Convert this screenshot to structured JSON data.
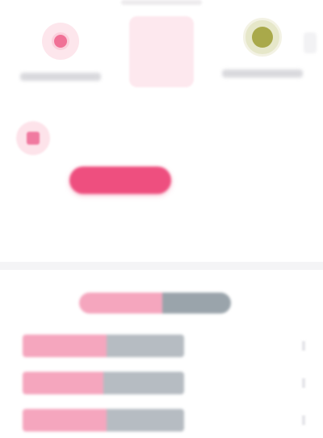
{
  "header": {
    "home_team": {
      "crest_icon": "club-crest-icon",
      "name": "",
      "color": "#f07196"
    },
    "away_team": {
      "crest_icon": "club-crest-icon",
      "name": "",
      "color": "#a9a94a"
    },
    "score": "",
    "status": ""
  },
  "tabs": {
    "icon": "match-icon",
    "items": [
      "",
      "",
      ""
    ]
  },
  "pills": {
    "items": [
      "",
      "",
      ""
    ],
    "active_index": 1,
    "accent": "#ee4f7f"
  },
  "options": {
    "items": [
      "",
      "",
      ""
    ],
    "sub": ""
  },
  "stats": {
    "left_label": "",
    "right_label": "",
    "home_color": "#f5a6be",
    "away_color": "#b6bcc2",
    "legend_home_share": 0.55,
    "rows": [
      {
        "home_share": 0.52
      },
      {
        "home_share": 0.5
      },
      {
        "home_share": 0.52
      }
    ]
  }
}
